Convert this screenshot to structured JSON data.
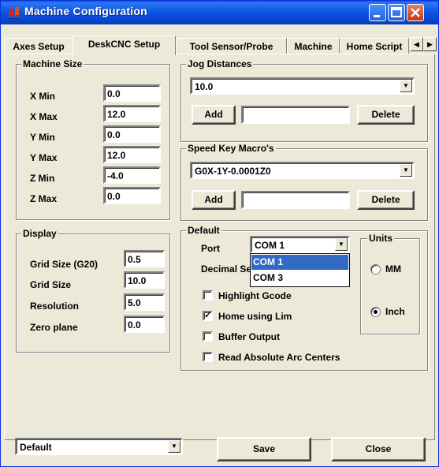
{
  "window": {
    "title": "Machine Configuration"
  },
  "tabs": [
    {
      "label": "Axes Setup"
    },
    {
      "label": "DeskCNC Setup",
      "active": true
    },
    {
      "label": "Tool Sensor/Probe"
    },
    {
      "label": "Machine"
    },
    {
      "label": "Home Script"
    }
  ],
  "machine_size": {
    "title": "Machine Size",
    "fields": [
      {
        "label": "X Min",
        "value": "0.0"
      },
      {
        "label": "X Max",
        "value": "12.0"
      },
      {
        "label": "Y Min",
        "value": "0.0"
      },
      {
        "label": "Y Max",
        "value": "12.0"
      },
      {
        "label": "Z Min",
        "value": "-4.0"
      },
      {
        "label": "Z Max",
        "value": "0.0"
      }
    ]
  },
  "jog_distances": {
    "title": "Jog Distances",
    "selected": "10.0",
    "add_label": "Add",
    "delete_label": "Delete",
    "input_value": ""
  },
  "speed_key": {
    "title": "Speed Key Macro's",
    "selected": "G0X-1Y-0.0001Z0",
    "add_label": "Add",
    "delete_label": "Delete",
    "input_value": ""
  },
  "display": {
    "title": "Display",
    "fields": [
      {
        "label": "Grid Size (G20)",
        "value": "0.5"
      },
      {
        "label": "Grid Size",
        "value": "10.0"
      },
      {
        "label": "Resolution",
        "value": "5.0"
      },
      {
        "label": "Zero plane",
        "value": "0.0"
      }
    ]
  },
  "default_group": {
    "title": "Default",
    "port_label": "Port",
    "port_selected": "COM 1",
    "port_options": [
      "COM 1",
      "COM 3"
    ],
    "decimal_label": "Decimal Se",
    "checkboxes": [
      {
        "label": "Highlight Gcode",
        "checked": false
      },
      {
        "label": "Home using Lim",
        "checked": true
      },
      {
        "label": "Buffer Output",
        "checked": false
      },
      {
        "label": "Read Absolute Arc Centers",
        "checked": false
      }
    ],
    "units": {
      "title": "Units",
      "options": [
        {
          "label": "MM",
          "selected": false
        },
        {
          "label": "Inch",
          "selected": true
        }
      ]
    }
  },
  "footer": {
    "profile_selected": "Default",
    "save_label": "Save",
    "close_label": "Close"
  },
  "colors": {
    "titlebar": "#0b57e3",
    "selection": "#316ac5",
    "face": "#ece9d8"
  }
}
